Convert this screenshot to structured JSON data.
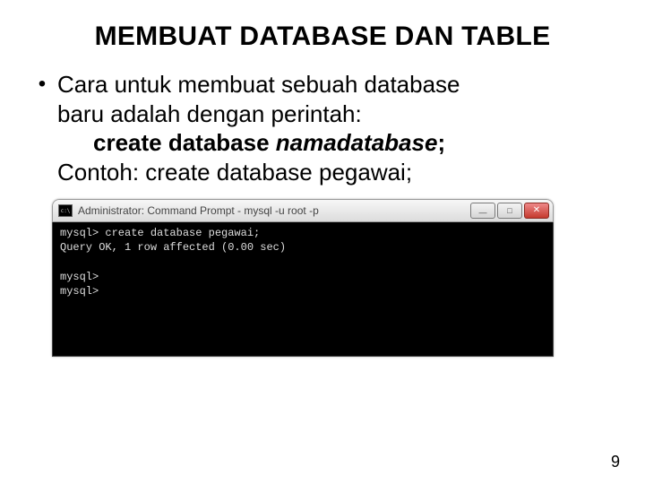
{
  "title": "MEMBUAT DATABASE DAN TABLE",
  "bullet_glyph": "•",
  "bullet1_line1": "Cara untuk membuat sebuah database",
  "bullet1_line2": "baru adalah dengan perintah:",
  "cmd_prefix": "create database ",
  "cmd_var": "namadatabase",
  "cmd_suffix": ";",
  "example": "Contoh: create database pegawai;",
  "terminal": {
    "window_title": "Administrator: Command Prompt - mysql  -u root -p",
    "lines": "mysql> create database pegawai;\nQuery OK, 1 row affected (0.00 sec)\n\nmysql>\nmysql>"
  },
  "page_number": "9"
}
